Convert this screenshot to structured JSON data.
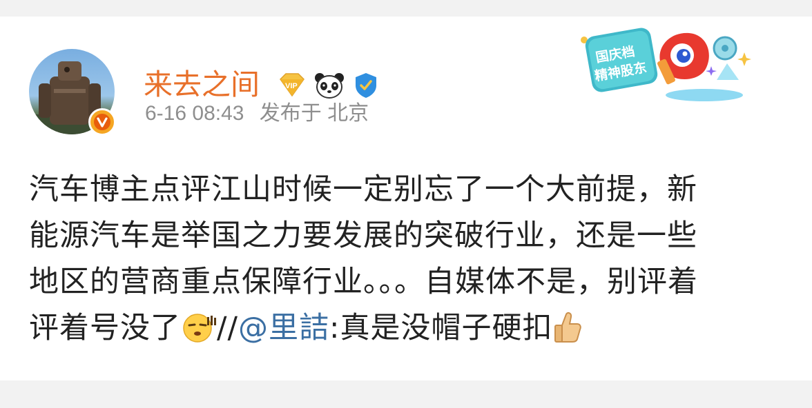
{
  "user": {
    "name": "来去之间",
    "avatar_icon": "robot-statue-avatar",
    "verified_icon": "orange-v-badge",
    "badges": [
      "vip-diamond-icon",
      "panda-icon",
      "blue-shield-check-icon"
    ]
  },
  "meta": {
    "time": "6-16 08:43",
    "location": "发布于 北京"
  },
  "promo": {
    "line1": "国庆档",
    "line2": "精神股东"
  },
  "post": {
    "line1": "汽车博主点评江山时候一定别忘了一个大前提，新",
    "line2": "能源汽车是举国之力要发展的突破行业，还是一些",
    "line3": "地区的营商重点保障行业。。。自媒体不是，别评着",
    "line4_start": "评着号没了",
    "repost_sep": "//",
    "mention": "@里詰",
    "repost_text": ":真是没帽子硬扣"
  },
  "colors": {
    "username": "#e8702a",
    "mention": "#3b6fa3",
    "meta": "#8e8e8e",
    "text": "#222222"
  }
}
